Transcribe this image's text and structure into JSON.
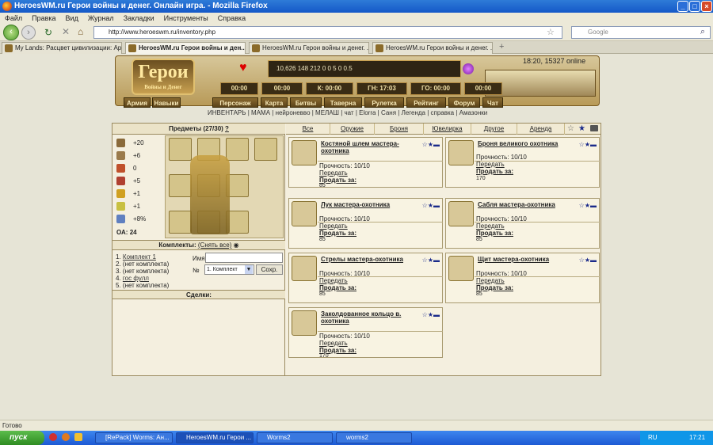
{
  "window": {
    "title": "HeroesWM.ru Герои войны и денег. Онлайн игра. - Mozilla Firefox"
  },
  "menu": [
    "Файл",
    "Правка",
    "Вид",
    "Журнал",
    "Закладки",
    "Инструменты",
    "Справка"
  ],
  "nav": {
    "url": "http://www.heroeswm.ru/inventory.php",
    "search_placeholder": "Google"
  },
  "tabs": [
    {
      "label": "My Lands: Расцвет цивилизации: Арх..."
    },
    {
      "label": "HeroesWM.ru Герои войны и ден..."
    },
    {
      "label": "HeroesWM.ru Герои войны и денег. ..."
    },
    {
      "label": "HeroesWM.ru Герои войны и денег. ..."
    }
  ],
  "game": {
    "clock": "18:20, 15327 online",
    "logo_text": "Герои",
    "logo_sub": "Войны и Денег",
    "resources": "10,626   148   212   0   0   5   0   0.5",
    "timers": [
      "00:00",
      "00:00",
      "К: 00:00",
      "ГН: 17:03",
      "ГО: 00:00",
      "00:00"
    ],
    "army_label": "Армия",
    "skills_label": "Навыки",
    "nav_links": [
      "Персонаж",
      "Карта",
      "Битвы",
      "Таверна",
      "Рулетка",
      "Рейтинг",
      "Форум",
      "Чат"
    ],
    "sub_links": "ИНВЕНТАРЬ | МАМА | нейроневво | МЕЛАШ | чат | Elorra | Саня | Легенда | справка | Амазонки"
  },
  "inventory": {
    "title": "Предметы (27/30)",
    "help": "?",
    "stats": [
      {
        "icon": "attack-icon",
        "value": "+20",
        "color": "#8a6a3a"
      },
      {
        "icon": "defense-icon",
        "value": "+6",
        "color": "#9a7a4a"
      },
      {
        "icon": "magic-icon",
        "value": "0",
        "color": "#c0502a"
      },
      {
        "icon": "knowledge-icon",
        "value": "+5",
        "color": "#b04030"
      },
      {
        "icon": "luck-icon",
        "value": "+1",
        "color": "#d0a020"
      },
      {
        "icon": "morale-icon",
        "value": "+1",
        "color": "#c8c040"
      },
      {
        "icon": "initiative-icon",
        "value": "+8%",
        "color": "#6080c0"
      }
    ],
    "oa_label": "ОА:",
    "oa_value": "24",
    "sets_title": "Комплекты:",
    "sets_remove": "(Снять все)",
    "sets": [
      {
        "n": "1.",
        "label": "Комплект 1"
      },
      {
        "n": "2.",
        "label": "(нет комплекта)"
      },
      {
        "n": "3.",
        "label": "(нет комплекта)"
      },
      {
        "n": "4.",
        "label": "гос фулл"
      },
      {
        "n": "5.",
        "label": "(нет комплекта)"
      }
    ],
    "name_label": "Имя",
    "no_label": "№",
    "set_select": "1. Комплект",
    "save_button": "Сохр.",
    "deals_title": "Сделки:"
  },
  "filters": [
    "Все",
    "Оружие",
    "Броня",
    "Ювелирка",
    "Другое",
    "Аренда"
  ],
  "items": [
    {
      "name": "Костяной шлем мастера-охотника",
      "durability": "Прочность: 10/10",
      "transfer": "Передать",
      "sell": "Продать за:",
      "price": "85"
    },
    {
      "name": "Броня великого охотника",
      "durability": "Прочность: 10/10",
      "transfer": "Передать",
      "sell": "Продать за:",
      "price": "170"
    },
    {
      "name": "Лук мастера-охотника",
      "durability": "Прочность: 10/10",
      "transfer": "Передать",
      "sell": "Продать за:",
      "price": "85"
    },
    {
      "name": "Сабля мастера-охотника",
      "durability": "Прочность: 10/10",
      "transfer": "Передать",
      "sell": "Продать за:",
      "price": "85"
    },
    {
      "name": "Стрелы мастера-охотника",
      "durability": "Прочность: 10/10",
      "transfer": "Передать",
      "sell": "Продать за:",
      "price": "85"
    },
    {
      "name": "Щит мастера-охотника",
      "durability": "Прочность: 10/10",
      "transfer": "Передать",
      "sell": "Продать за:",
      "price": "85"
    },
    {
      "name": "Заколдованное кольцо в. охотника",
      "durability": "Прочность: 10/10",
      "transfer": "Передать",
      "sell": "Продать за:",
      "price": "170"
    }
  ],
  "status": "Готово",
  "taskbar": {
    "start": "пуск",
    "tasks": [
      "[RePack] Worms: Ан...",
      "HeroesWM.ru Герои ...",
      "Worms2",
      "worms2"
    ],
    "lang": "RU",
    "time": "17:21"
  }
}
